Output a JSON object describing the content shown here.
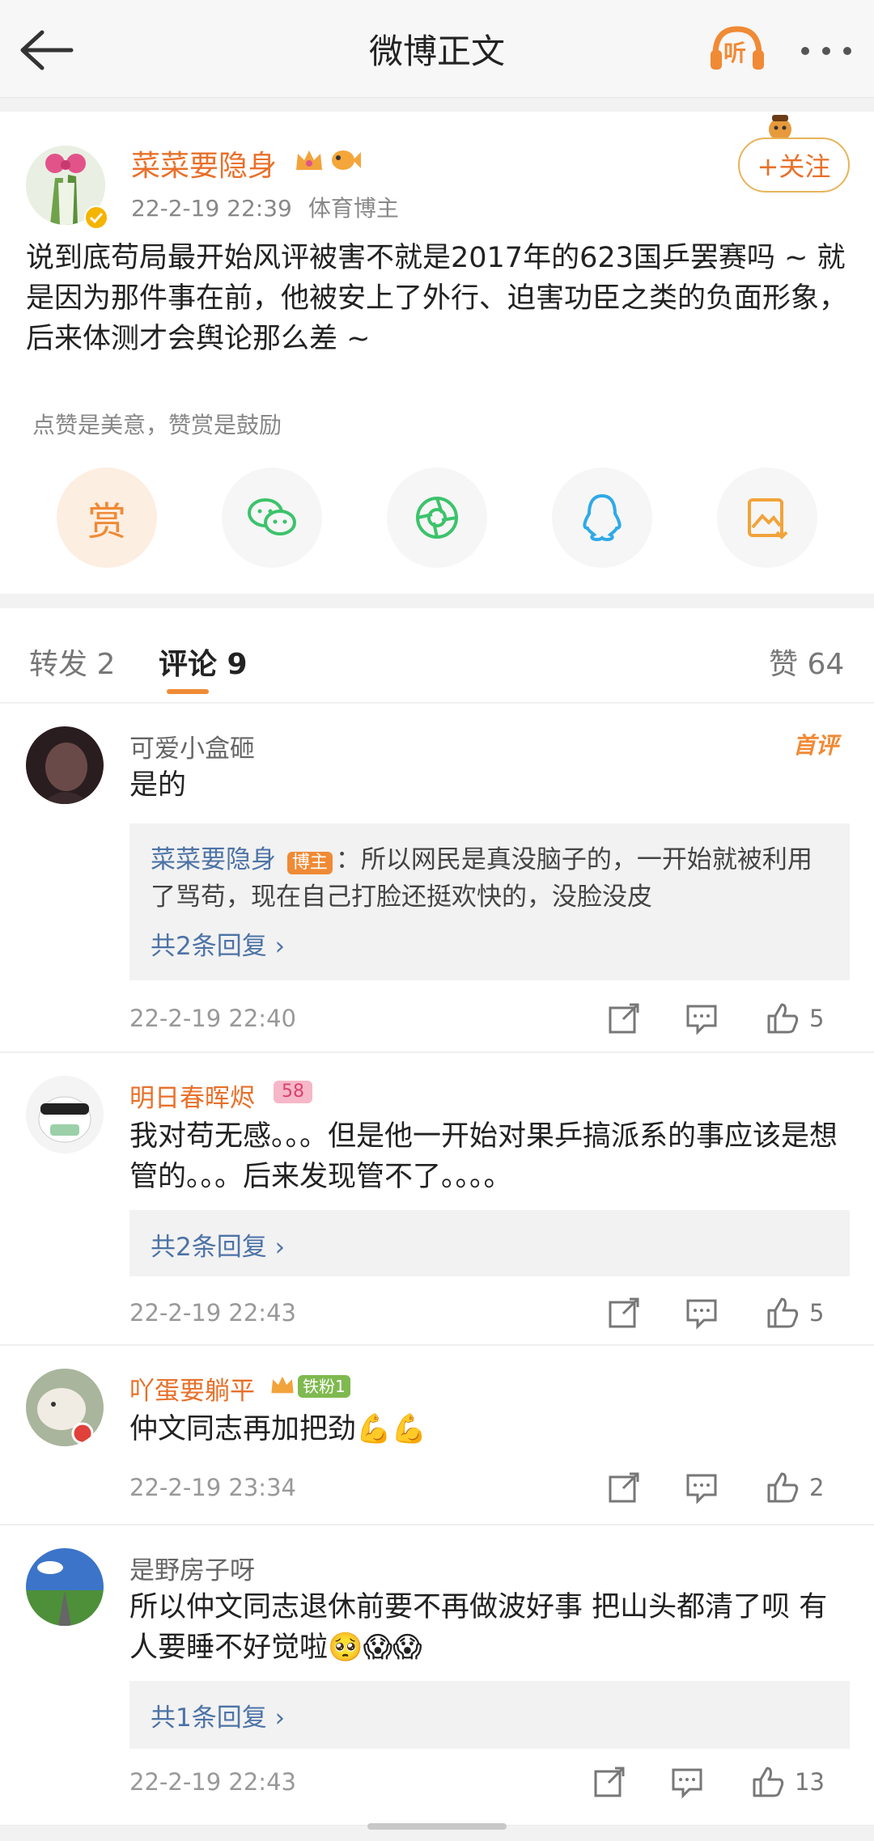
{
  "header": {
    "title": "微博正文",
    "listen_label": "听"
  },
  "post": {
    "author": "菜菜要隐身",
    "time": "22-2-19 22:39",
    "tag": "体育博主",
    "follow_label": "+关注",
    "content": "说到底苟局最开始风评被害不就是2017年的623国乒罢赛吗 ~ 就是因为那件事在前，他被安上了外行、迫害功臣之类的负面形象，后来体测才会舆论那么差 ~",
    "reward_hint": "点赞是美意，赞赏是鼓励",
    "reward_label": "赏"
  },
  "tabs": {
    "repost": "转发 2",
    "comment": "评论 9",
    "like": "赞 64"
  },
  "comments": [
    {
      "name": "可爱小盒砸",
      "first_tag": "首评",
      "text": "是的",
      "reply_author": "菜菜要隐身",
      "reply_badge": "博主",
      "reply_text": "：所以网民是真没脑子的，一开始就被利用了骂苟，现在自己打脸还挺欢快的，没脸没皮",
      "reply_more": "共2条回复 ›",
      "time": "22-2-19 22:40",
      "likes": "5"
    },
    {
      "name": "明日春晖烬",
      "level": "58",
      "text": "我对苟无感。。。但是他一开始对果乒搞派系的事应该是想管的。。。后来发现管不了。。。。",
      "reply_more": "共2条回复 ›",
      "time": "22-2-19 22:43",
      "likes": "5"
    },
    {
      "name": "吖蛋要躺平",
      "fan": "铁粉1",
      "text": "仲文同志再加把劲💪💪",
      "time": "22-2-19 23:34",
      "likes": "2"
    },
    {
      "name": "是野房子呀",
      "text": "所以仲文同志退休前要不再做波好事 把山头都清了呗 有人要睡不好觉啦🥺😱😱",
      "reply_more": "共1条回复 ›",
      "time": "22-2-19 22:43",
      "likes": "13"
    }
  ],
  "colors": {
    "accent": "#f08a35",
    "name": "#e8702a",
    "link": "#4d73a6"
  },
  "icons": [
    "back-arrow-icon",
    "headphones-icon",
    "more-icon",
    "wechat-icon",
    "moments-icon",
    "qq-icon",
    "save-image-icon",
    "repost-icon",
    "comment-icon",
    "like-icon"
  ]
}
